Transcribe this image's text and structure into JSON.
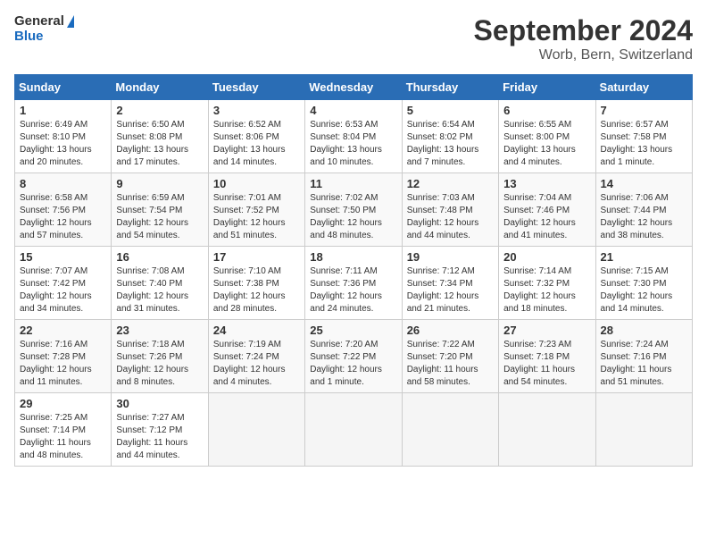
{
  "header": {
    "logo_line1": "General",
    "logo_line2": "Blue",
    "title": "September 2024",
    "subtitle": "Worb, Bern, Switzerland"
  },
  "days_of_week": [
    "Sunday",
    "Monday",
    "Tuesday",
    "Wednesday",
    "Thursday",
    "Friday",
    "Saturday"
  ],
  "weeks": [
    [
      {
        "day": 1,
        "sunrise": "6:49 AM",
        "sunset": "8:10 PM",
        "daylight": "13 hours and 20 minutes."
      },
      {
        "day": 2,
        "sunrise": "6:50 AM",
        "sunset": "8:08 PM",
        "daylight": "13 hours and 17 minutes."
      },
      {
        "day": 3,
        "sunrise": "6:52 AM",
        "sunset": "8:06 PM",
        "daylight": "13 hours and 14 minutes."
      },
      {
        "day": 4,
        "sunrise": "6:53 AM",
        "sunset": "8:04 PM",
        "daylight": "13 hours and 10 minutes."
      },
      {
        "day": 5,
        "sunrise": "6:54 AM",
        "sunset": "8:02 PM",
        "daylight": "13 hours and 7 minutes."
      },
      {
        "day": 6,
        "sunrise": "6:55 AM",
        "sunset": "8:00 PM",
        "daylight": "13 hours and 4 minutes."
      },
      {
        "day": 7,
        "sunrise": "6:57 AM",
        "sunset": "7:58 PM",
        "daylight": "13 hours and 1 minute."
      }
    ],
    [
      {
        "day": 8,
        "sunrise": "6:58 AM",
        "sunset": "7:56 PM",
        "daylight": "12 hours and 57 minutes."
      },
      {
        "day": 9,
        "sunrise": "6:59 AM",
        "sunset": "7:54 PM",
        "daylight": "12 hours and 54 minutes."
      },
      {
        "day": 10,
        "sunrise": "7:01 AM",
        "sunset": "7:52 PM",
        "daylight": "12 hours and 51 minutes."
      },
      {
        "day": 11,
        "sunrise": "7:02 AM",
        "sunset": "7:50 PM",
        "daylight": "12 hours and 48 minutes."
      },
      {
        "day": 12,
        "sunrise": "7:03 AM",
        "sunset": "7:48 PM",
        "daylight": "12 hours and 44 minutes."
      },
      {
        "day": 13,
        "sunrise": "7:04 AM",
        "sunset": "7:46 PM",
        "daylight": "12 hours and 41 minutes."
      },
      {
        "day": 14,
        "sunrise": "7:06 AM",
        "sunset": "7:44 PM",
        "daylight": "12 hours and 38 minutes."
      }
    ],
    [
      {
        "day": 15,
        "sunrise": "7:07 AM",
        "sunset": "7:42 PM",
        "daylight": "12 hours and 34 minutes."
      },
      {
        "day": 16,
        "sunrise": "7:08 AM",
        "sunset": "7:40 PM",
        "daylight": "12 hours and 31 minutes."
      },
      {
        "day": 17,
        "sunrise": "7:10 AM",
        "sunset": "7:38 PM",
        "daylight": "12 hours and 28 minutes."
      },
      {
        "day": 18,
        "sunrise": "7:11 AM",
        "sunset": "7:36 PM",
        "daylight": "12 hours and 24 minutes."
      },
      {
        "day": 19,
        "sunrise": "7:12 AM",
        "sunset": "7:34 PM",
        "daylight": "12 hours and 21 minutes."
      },
      {
        "day": 20,
        "sunrise": "7:14 AM",
        "sunset": "7:32 PM",
        "daylight": "12 hours and 18 minutes."
      },
      {
        "day": 21,
        "sunrise": "7:15 AM",
        "sunset": "7:30 PM",
        "daylight": "12 hours and 14 minutes."
      }
    ],
    [
      {
        "day": 22,
        "sunrise": "7:16 AM",
        "sunset": "7:28 PM",
        "daylight": "12 hours and 11 minutes."
      },
      {
        "day": 23,
        "sunrise": "7:18 AM",
        "sunset": "7:26 PM",
        "daylight": "12 hours and 8 minutes."
      },
      {
        "day": 24,
        "sunrise": "7:19 AM",
        "sunset": "7:24 PM",
        "daylight": "12 hours and 4 minutes."
      },
      {
        "day": 25,
        "sunrise": "7:20 AM",
        "sunset": "7:22 PM",
        "daylight": "12 hours and 1 minute."
      },
      {
        "day": 26,
        "sunrise": "7:22 AM",
        "sunset": "7:20 PM",
        "daylight": "11 hours and 58 minutes."
      },
      {
        "day": 27,
        "sunrise": "7:23 AM",
        "sunset": "7:18 PM",
        "daylight": "11 hours and 54 minutes."
      },
      {
        "day": 28,
        "sunrise": "7:24 AM",
        "sunset": "7:16 PM",
        "daylight": "11 hours and 51 minutes."
      }
    ],
    [
      {
        "day": 29,
        "sunrise": "7:25 AM",
        "sunset": "7:14 PM",
        "daylight": "11 hours and 48 minutes."
      },
      {
        "day": 30,
        "sunrise": "7:27 AM",
        "sunset": "7:12 PM",
        "daylight": "11 hours and 44 minutes."
      },
      null,
      null,
      null,
      null,
      null
    ]
  ]
}
